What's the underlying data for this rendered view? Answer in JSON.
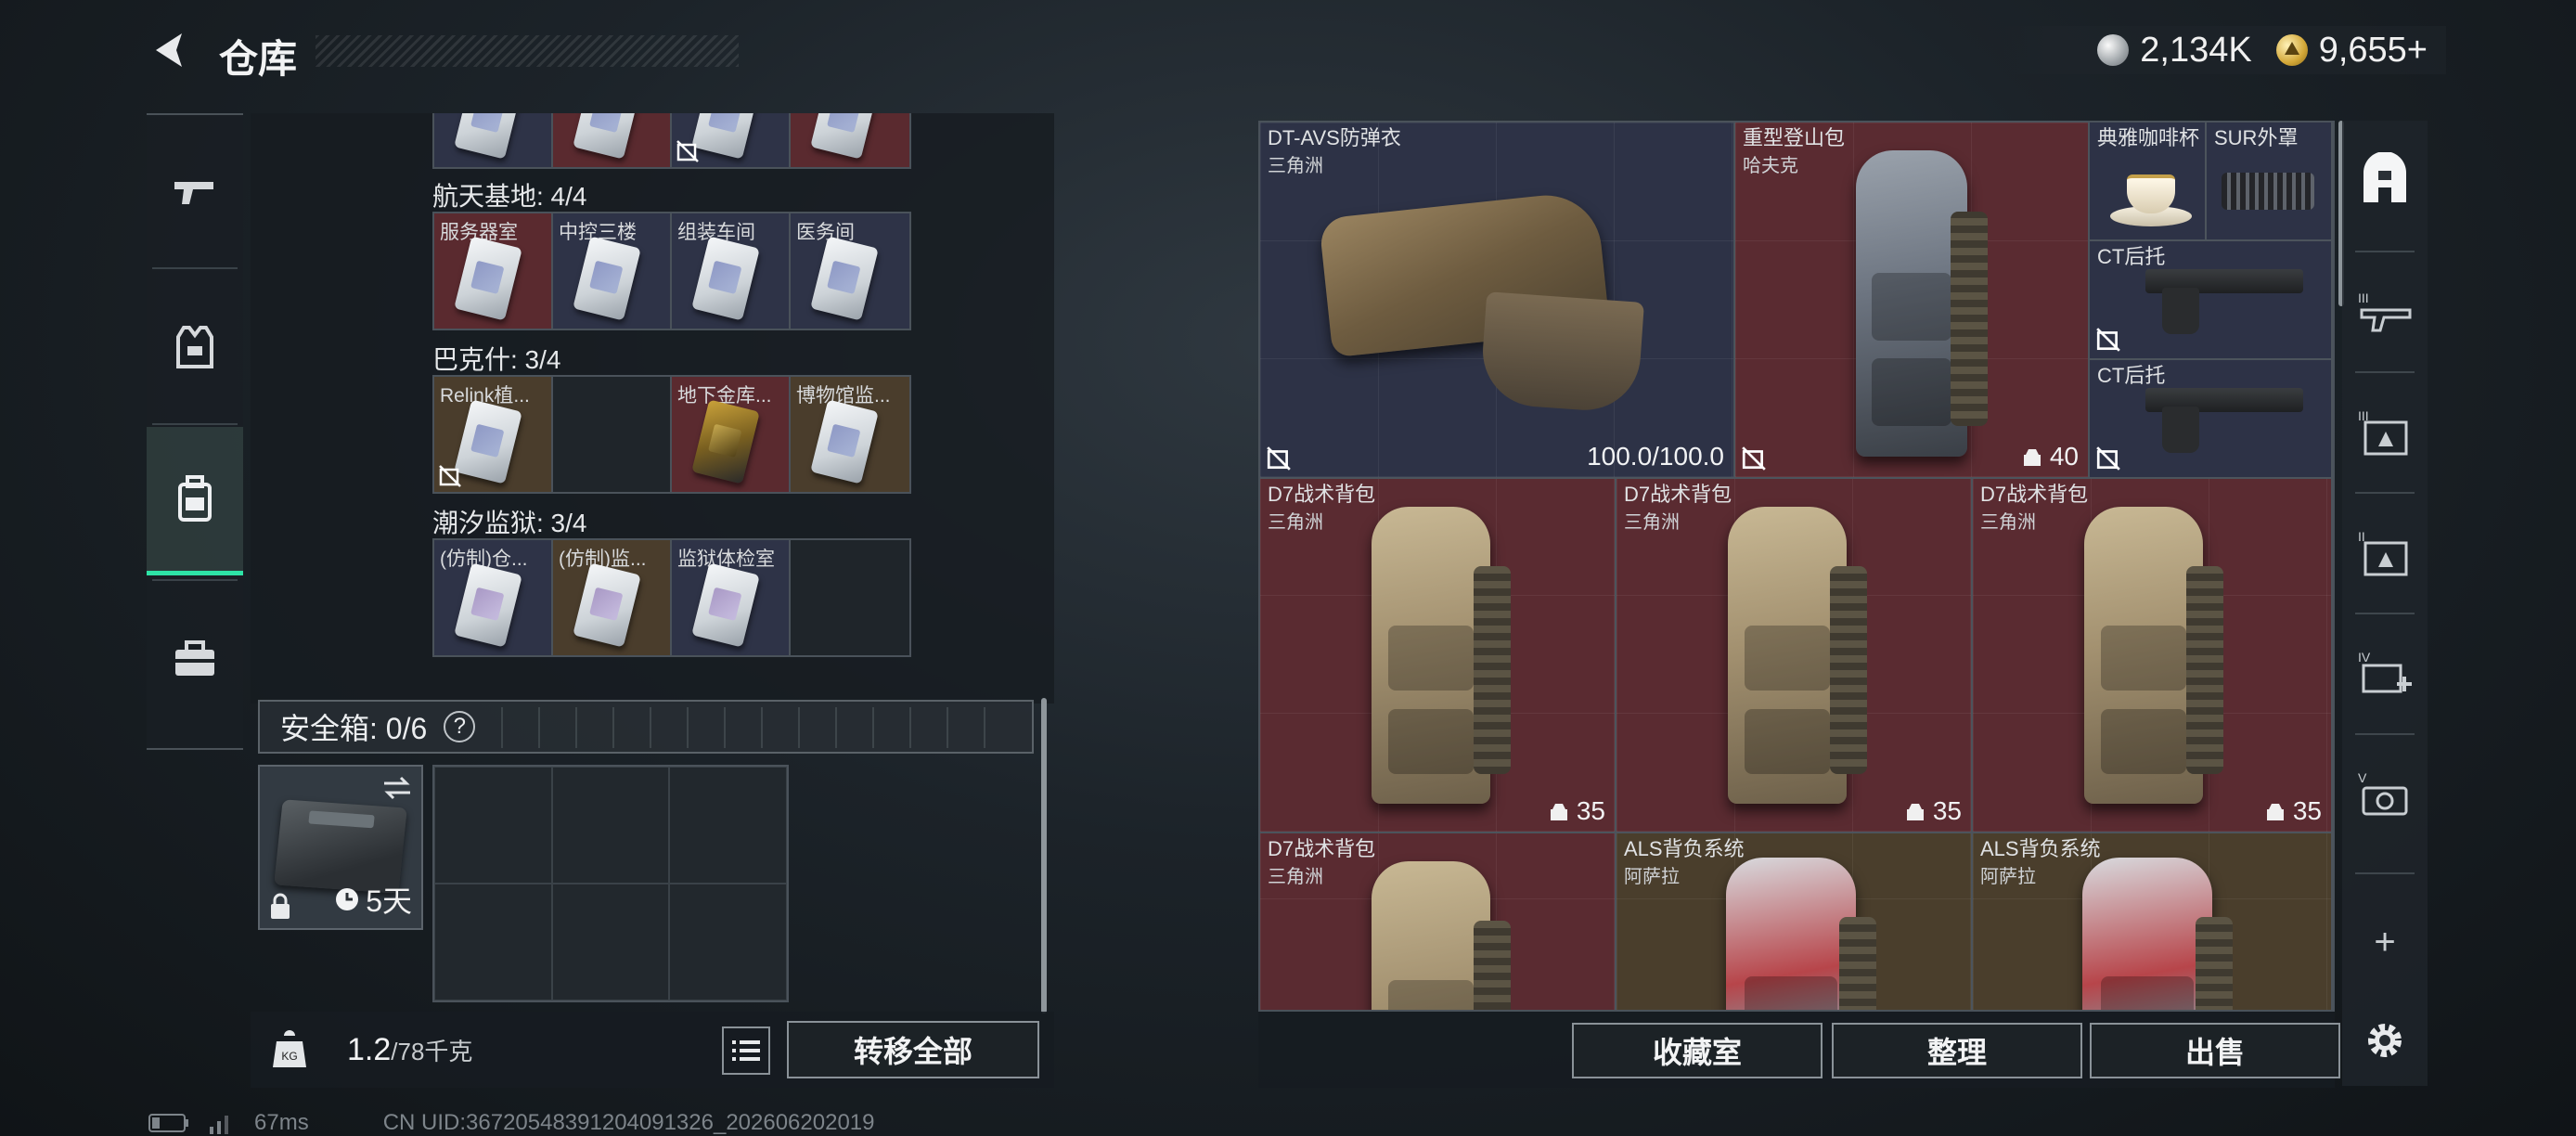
{
  "header": {
    "title": "仓库"
  },
  "currency": {
    "silver": "2,134K",
    "gold": "9,655+"
  },
  "left_rail": {
    "items": [
      {
        "icon": "gun-icon"
      },
      {
        "icon": "vest-icon"
      },
      {
        "icon": "backpack-icon",
        "active": true
      },
      {
        "icon": "toolbox-icon"
      }
    ]
  },
  "stash": {
    "sections": [
      {
        "label": "航天基地: 4/4",
        "cells": [
          {
            "label": "服务器室",
            "color": "red"
          },
          {
            "label": "中控三楼",
            "color": "blue"
          },
          {
            "label": "组装车间",
            "color": "blue"
          },
          {
            "label": "医务间",
            "color": "blue"
          }
        ]
      },
      {
        "label": "巴克什: 3/4",
        "cells": [
          {
            "label": "Relink植...",
            "color": "gold"
          },
          {
            "label": "",
            "color": "empty"
          },
          {
            "label": "地下金库...",
            "color": "red"
          },
          {
            "label": "博物馆监...",
            "color": "gold"
          }
        ]
      },
      {
        "label": "潮汐监狱: 3/4",
        "cells": [
          {
            "label": "(仿制)仓...",
            "color": "blue"
          },
          {
            "label": "(仿制)监...",
            "color": "gold"
          },
          {
            "label": "监狱体检室",
            "color": "blue"
          },
          {
            "label": "",
            "color": "empty"
          }
        ]
      }
    ]
  },
  "safebox": {
    "label": "安全箱: 0/6",
    "help": "?",
    "timer": "5天"
  },
  "weight": {
    "current": "1.2",
    "capacity": "/78千克"
  },
  "transfer_all": "转移全部",
  "inventory": {
    "items": [
      {
        "name": "DT-AVS防弹衣",
        "sub": "三角洲",
        "value": "100.0/100.0",
        "color": "blue"
      },
      {
        "name": "重型登山包",
        "sub": "哈夫克",
        "value": "40",
        "color": "red"
      },
      {
        "name": "典雅咖啡杯",
        "sub": "",
        "value": "",
        "color": "blue"
      },
      {
        "name": "SUR外罩",
        "sub": "",
        "value": "",
        "color": "blue"
      },
      {
        "name": "CT后托",
        "sub": "",
        "value": "",
        "color": "blue"
      },
      {
        "name": "CT后托",
        "sub": "",
        "value": "",
        "color": "blue"
      },
      {
        "name": "D7战术背包",
        "sub": "三角洲",
        "value": "35",
        "color": "red"
      },
      {
        "name": "D7战术背包",
        "sub": "三角洲",
        "value": "35",
        "color": "red"
      },
      {
        "name": "D7战术背包",
        "sub": "三角洲",
        "value": "35",
        "color": "red"
      },
      {
        "name": "D7战术背包",
        "sub": "三角洲",
        "value": "",
        "color": "red"
      },
      {
        "name": "ALS背负系统",
        "sub": "阿萨拉",
        "value": "",
        "color": "gold"
      },
      {
        "name": "ALS背负系统",
        "sub": "阿萨拉",
        "value": "",
        "color": "gold"
      }
    ]
  },
  "buttons": {
    "collection": "收藏室",
    "organize": "整理",
    "sell": "出售"
  },
  "right_rail": {
    "items": [
      {
        "icon": "stash-icon"
      },
      {
        "icon": "tier-3-gun-icon"
      },
      {
        "icon": "tier-3-armor-icon"
      },
      {
        "icon": "tier-2-armor-icon"
      },
      {
        "icon": "tier-4-medical-icon"
      },
      {
        "icon": "tier-5-camera-icon"
      }
    ],
    "add": "+"
  },
  "status": {
    "ping": "67ms",
    "uid": "CN UID:3672054839120409132​6_202606202019"
  },
  "colors": {
    "accent": "#2ee3a6",
    "red_rarity": "#5a2b31",
    "blue_rarity": "#2d3246",
    "gold_rarity": "#4a3e2c"
  }
}
